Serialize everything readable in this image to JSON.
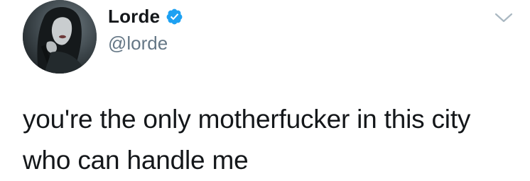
{
  "author": {
    "display_name": "Lorde",
    "handle": "@lorde",
    "verified": true,
    "avatar_icon": "profile-photo"
  },
  "tweet": {
    "text": "you're the only motherfucker in this city who can handle me"
  },
  "menu": {
    "icon": "chevron-down-icon"
  },
  "colors": {
    "verified_badge": "#1da1f2",
    "text": "#14171a",
    "secondary_text": "#657786",
    "caret": "#aab8c2"
  }
}
